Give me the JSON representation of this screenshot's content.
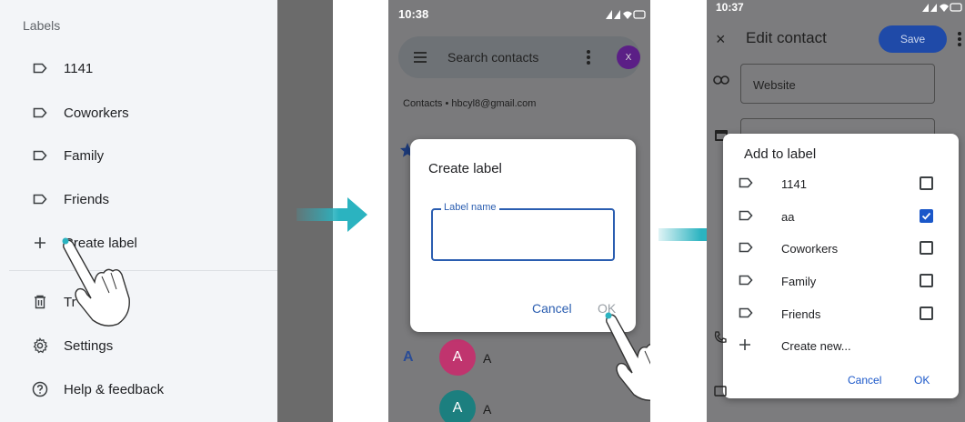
{
  "panel1": {
    "labels_heading": "Labels",
    "labels": [
      "1141",
      "Coworkers",
      "Family",
      "Friends"
    ],
    "create_label": "Create label",
    "trash_partial": "Tr",
    "settings": "Settings",
    "help": "Help & feedback"
  },
  "panel2": {
    "time": "10:38",
    "search_placeholder": "Search contacts",
    "avatar_letter": "X",
    "account": "Contacts • hbcyl8@gmail.com",
    "dialog": {
      "title": "Create label",
      "field_label": "Label name",
      "field_value": "",
      "cancel": "Cancel",
      "ok": "OK"
    },
    "section_letter": "A",
    "contacts": [
      {
        "initial": "A",
        "name": "A",
        "color": "#c0346e"
      },
      {
        "initial": "A",
        "name": "A",
        "color": "#1c7f7f"
      }
    ]
  },
  "panel3": {
    "time": "10:37",
    "close": "×",
    "title": "Edit contact",
    "save": "Save",
    "website_placeholder": "Website",
    "dialog": {
      "title": "Add to label",
      "options": [
        {
          "label": "1141",
          "checked": false
        },
        {
          "label": "aa",
          "checked": true
        },
        {
          "label": "Coworkers",
          "checked": false
        },
        {
          "label": "Family",
          "checked": false
        },
        {
          "label": "Friends",
          "checked": false
        }
      ],
      "create_new": "Create new...",
      "cancel": "Cancel",
      "ok": "OK"
    }
  },
  "colors": {
    "accent_blue": "#2a5db0",
    "arrow": "#2bb3c0",
    "drawer_bg": "#f3f5f8",
    "scrim": "#7a7a7c"
  }
}
